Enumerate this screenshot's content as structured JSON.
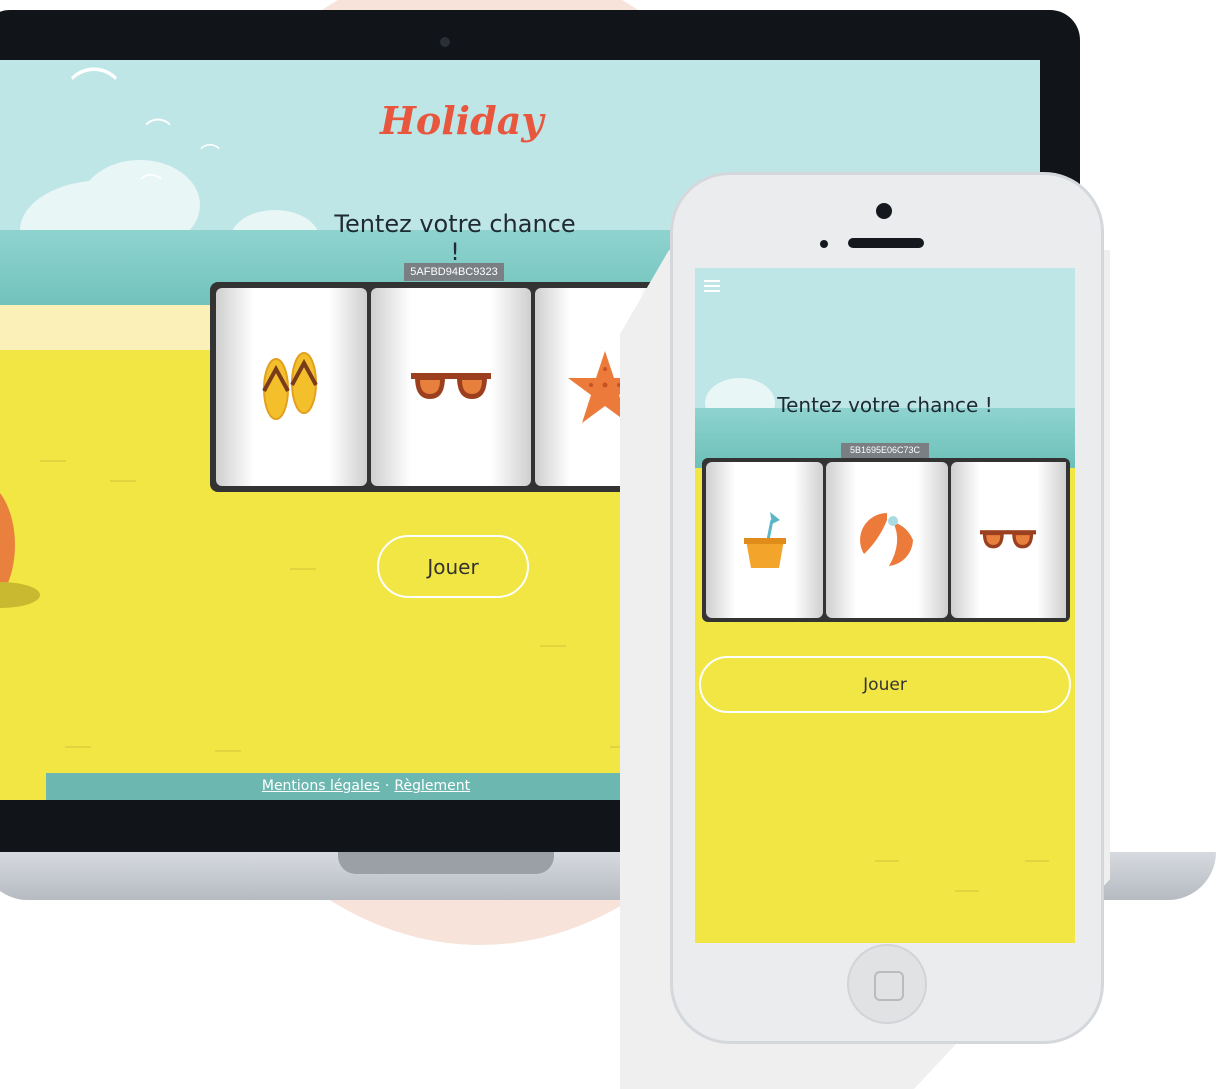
{
  "brand": {
    "logo_text": "Holiday"
  },
  "desktop": {
    "title": "Tentez votre chance !",
    "code": "5AFBD94BC9323",
    "reels": [
      "flip-flops-icon",
      "sunglasses-icon",
      "starfish-icon"
    ],
    "play_button": "Jouer",
    "footer": {
      "legal_link": "Mentions légales",
      "separator": "·",
      "rules_link": "Règlement"
    }
  },
  "mobile": {
    "title": "Tentez votre chance !",
    "code": "5B1695E06C73C",
    "reels": [
      "bucket-icon",
      "beach-ball-icon",
      "sunglasses-icon"
    ],
    "play_button": "Jouer"
  },
  "colors": {
    "sky": "#bfe6e7",
    "sea": "#6cc0b8",
    "sand": "#f2e644",
    "accent": "#e8573d",
    "footer": "#6cb8b0"
  }
}
